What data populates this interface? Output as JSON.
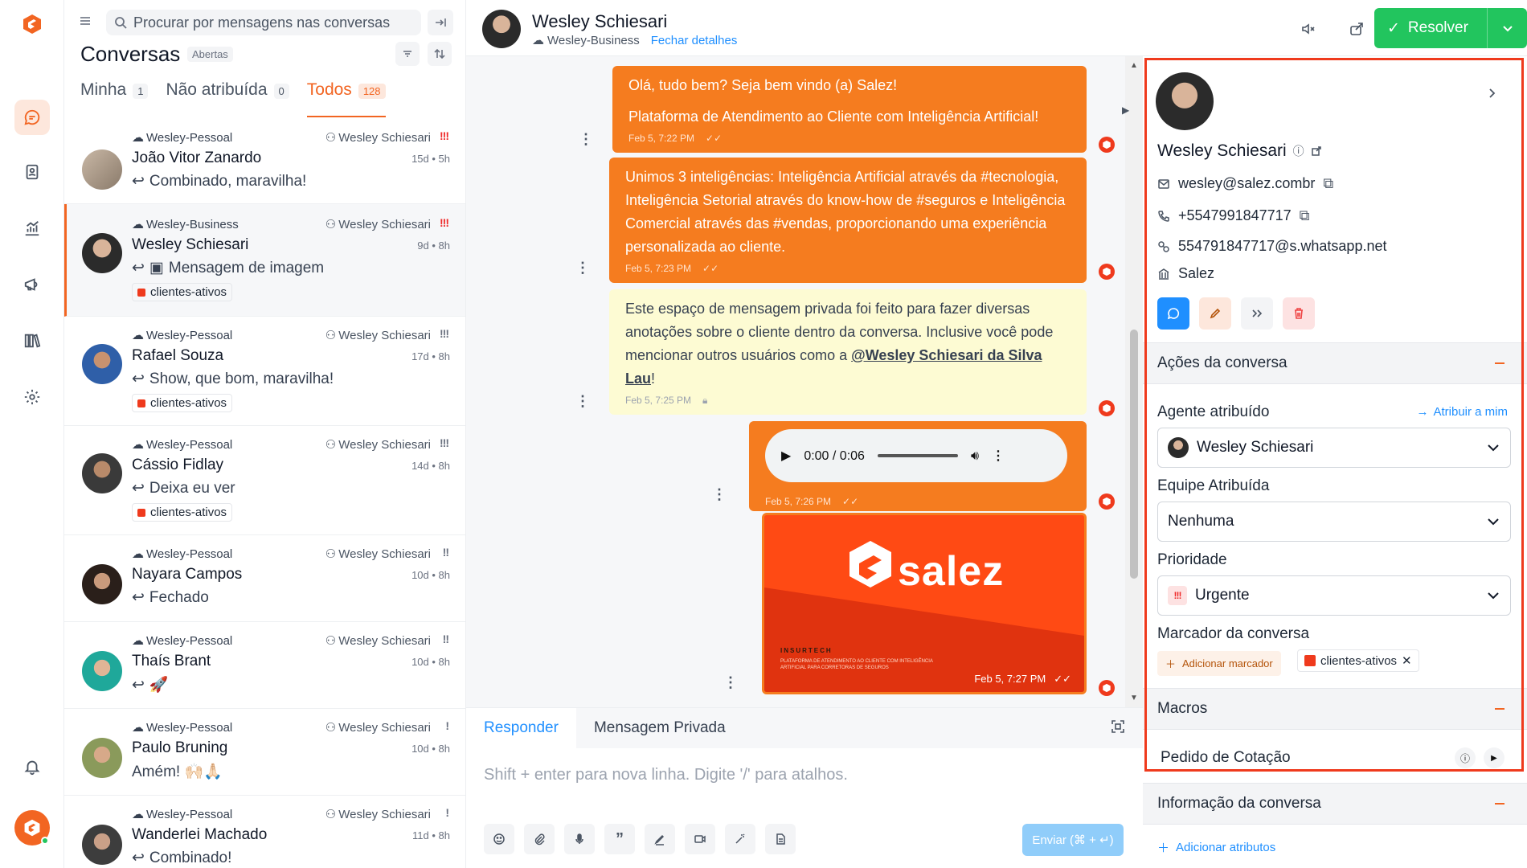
{
  "search": {
    "placeholder": "Procurar por mensagens nas conversas"
  },
  "list": {
    "title": "Conversas",
    "status": "Abertas",
    "tabs": [
      {
        "label": "Minha",
        "count": "1"
      },
      {
        "label": "Não atribuída",
        "count": "0"
      },
      {
        "label": "Todos",
        "count": "128"
      }
    ],
    "conversations": [
      {
        "inbox": "Wesley-Pessoal",
        "agent": "Wesley Schiesari",
        "priority": "!!!",
        "priority_color": "#ef2b2b",
        "name": "João Vitor Zanardo",
        "time": "15d • 5h",
        "last": "Combinado, maravilha!",
        "label": ""
      },
      {
        "inbox": "Wesley-Business",
        "agent": "Wesley Schiesari",
        "priority": "!!!",
        "priority_color": "#ef2b2b",
        "name": "Wesley Schiesari",
        "time": "9d • 8h",
        "last": "Mensagem de imagem",
        "label": "clientes-ativos"
      },
      {
        "inbox": "Wesley-Pessoal",
        "agent": "Wesley Schiesari",
        "priority": "!!!",
        "priority_color": "#6b7280",
        "name": "Rafael Souza",
        "time": "17d • 8h",
        "last": "Show, que bom, maravilha!",
        "label": "clientes-ativos"
      },
      {
        "inbox": "Wesley-Pessoal",
        "agent": "Wesley Schiesari",
        "priority": "!!!",
        "priority_color": "#6b7280",
        "name": "Cássio Fidlay",
        "time": "14d • 8h",
        "last": "Deixa eu ver",
        "label": "clientes-ativos"
      },
      {
        "inbox": "Wesley-Pessoal",
        "agent": "Wesley Schiesari",
        "priority": "!!",
        "priority_color": "#6b7280",
        "name": "Nayara Campos",
        "time": "10d • 8h",
        "last": "Fechado",
        "label": ""
      },
      {
        "inbox": "Wesley-Pessoal",
        "agent": "Wesley Schiesari",
        "priority": "!!",
        "priority_color": "#6b7280",
        "name": "Thaís Brant",
        "time": "10d • 8h",
        "last": "🚀",
        "label": ""
      },
      {
        "inbox": "Wesley-Pessoal",
        "agent": "Wesley Schiesari",
        "priority": "!",
        "priority_color": "#6b7280",
        "name": "Paulo Bruning",
        "time": "10d • 8h",
        "last": "Amém! 🙌🏻🙏🏻",
        "label": ""
      },
      {
        "inbox": "Wesley-Pessoal",
        "agent": "Wesley Schiesari",
        "priority": "!",
        "priority_color": "#6b7280",
        "name": "Wanderlei Machado",
        "time": "11d • 8h",
        "last": "Combinado!",
        "label": ""
      }
    ]
  },
  "header": {
    "name": "Wesley Schiesari",
    "inbox": "Wesley-Business",
    "details_link": "Fechar detalhes",
    "resolve_label": "Resolver"
  },
  "messages": [
    {
      "lines": [
        "Olá, tudo bem? Seja bem vindo (a) Salez!",
        "Plataforma de Atendimento ao Cliente com Inteligência Artificial!"
      ],
      "time": "Feb 5, 7:22 PM"
    },
    {
      "text": "Unimos 3 inteligências: Inteligência Artificial através da #tecnologia, Inteligência Setorial através do know-how de #seguros e Inteligência Comercial através das #vendas, proporcionando uma experiência personalizada ao cliente.",
      "time": "Feb 5, 7:23 PM"
    },
    {
      "text": "Este espaço de mensagem privada foi feito para fazer diversas anotações sobre o cliente dentro da conversa. Inclusive você pode mencionar outros usuários como a ",
      "mention": "@Wesley Schiesari da Silva Lau",
      "after": "!",
      "time": "Feb 5, 7:25 PM"
    },
    {
      "audio_time": "0:00 / 0:06",
      "time": "Feb 5, 7:26 PM"
    },
    {
      "brand": "salez",
      "tag": "INSURTECH",
      "caption": "PLATAFORMA DE ATENDIMENTO AO CLIENTE COM INTELIGÊNCIA ARTIFICIAL PARA CORRETORAS DE SEGUROS",
      "time": "Feb 5, 7:27 PM"
    }
  ],
  "composer": {
    "tab_reply": "Responder",
    "tab_private": "Mensagem Privada",
    "placeholder": "Shift + enter para nova linha. Digite '/' para atalhos.",
    "send_label": "Enviar (⌘ + ↵)"
  },
  "contact": {
    "name": "Wesley Schiesari",
    "email": "wesley@salez.combr",
    "phone": "+5547991847717",
    "identifier": "554791847717@s.whatsapp.net",
    "company": "Salez"
  },
  "actions": {
    "section_title": "Ações da conversa",
    "agent_label": "Agente atribuído",
    "assign_me": "Atribuir a mim",
    "agent_value": "Wesley Schiesari",
    "team_label": "Equipe Atribuída",
    "team_value": "Nenhuma",
    "priority_label": "Prioridade",
    "priority_value": "Urgente",
    "labels_label": "Marcador da conversa",
    "add_label": "Adicionar marcador",
    "label_value": "clientes-ativos"
  },
  "macros": {
    "title": "Macros",
    "item": "Pedido de Cotação"
  },
  "info": {
    "title": "Informação da conversa",
    "add_attributes": "Adicionar atributos"
  },
  "colors": {
    "brand": "#f26522",
    "bubble": "#f57c1f",
    "private_note": "#fdfbd3",
    "resolve": "#22c55e",
    "link": "#1f8fff",
    "highlight_box": "#ef3a1d"
  }
}
